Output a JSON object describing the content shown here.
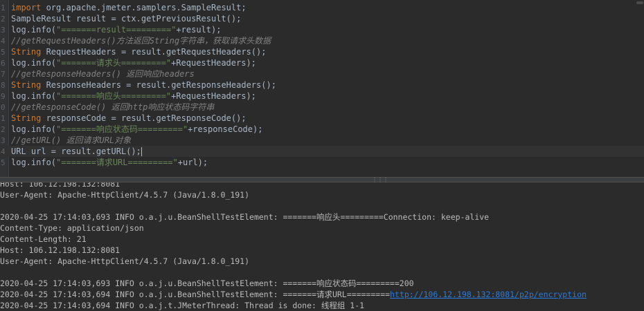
{
  "editor": {
    "lines": [
      {
        "n": "1",
        "parts": [
          {
            "t": "kw",
            "v": "import"
          },
          {
            "t": "plain",
            "v": " org.apache.jmeter.samplers.SampleResult;"
          }
        ]
      },
      {
        "n": "2",
        "parts": [
          {
            "t": "plain",
            "v": "SampleResult result = ctx.getPreviousResult();"
          }
        ]
      },
      {
        "n": "3",
        "parts": [
          {
            "t": "plain",
            "v": "log.info("
          },
          {
            "t": "str",
            "v": "\"=======result=========\""
          },
          {
            "t": "plain",
            "v": "+result);"
          }
        ]
      },
      {
        "n": "4",
        "parts": [
          {
            "t": "cmt",
            "v": "//getRequestHeaders()方法返回String字符串，获取请求头数据"
          }
        ]
      },
      {
        "n": "5",
        "parts": [
          {
            "t": "kw",
            "v": "String"
          },
          {
            "t": "plain",
            "v": " RequestHeaders = result.getRequestHeaders();"
          }
        ]
      },
      {
        "n": "6",
        "parts": [
          {
            "t": "plain",
            "v": "log.info("
          },
          {
            "t": "str",
            "v": "\"=======请求头=========\""
          },
          {
            "t": "plain",
            "v": "+RequestHeaders);"
          }
        ]
      },
      {
        "n": "7",
        "parts": [
          {
            "t": "cmt",
            "v": "//getResponseHeaders() 返回响应headers"
          }
        ]
      },
      {
        "n": "8",
        "parts": [
          {
            "t": "kw",
            "v": "String"
          },
          {
            "t": "plain",
            "v": " ResponseHeaders = result.getResponseHeaders();"
          }
        ]
      },
      {
        "n": "9",
        "parts": [
          {
            "t": "plain",
            "v": "log.info("
          },
          {
            "t": "str",
            "v": "\"=======响应头=========\""
          },
          {
            "t": "plain",
            "v": "+RequestHeaders);"
          }
        ]
      },
      {
        "n": "0",
        "parts": [
          {
            "t": "cmt",
            "v": "//getResponseCode() 返回http响应状态码字符串"
          }
        ]
      },
      {
        "n": "1",
        "parts": [
          {
            "t": "kw",
            "v": "String"
          },
          {
            "t": "plain",
            "v": " responseCode = result.getResponseCode();"
          }
        ]
      },
      {
        "n": "2",
        "parts": [
          {
            "t": "plain",
            "v": "log.info("
          },
          {
            "t": "str",
            "v": "\"=======响应状态码=========\""
          },
          {
            "t": "plain",
            "v": "+responseCode);"
          }
        ]
      },
      {
        "n": "3",
        "parts": [
          {
            "t": "cmt",
            "v": "//getURL() 返回请求URL对象"
          }
        ]
      },
      {
        "n": "4",
        "parts": [
          {
            "t": "plain",
            "v": "URL url = result.getURL();"
          }
        ],
        "active": true
      },
      {
        "n": "5",
        "parts": [
          {
            "t": "plain",
            "v": "log.info("
          },
          {
            "t": "str",
            "v": "\"=======请求URL=========\""
          },
          {
            "t": "plain",
            "v": "+url);"
          }
        ]
      }
    ]
  },
  "console": {
    "lines": [
      {
        "text": "Host: 106.12.198.132:8081"
      },
      {
        "text": "User-Agent: Apache-HttpClient/4.5.7 (Java/1.8.0_191)"
      },
      {
        "text": ""
      },
      {
        "text": "2020-04-25 17:14:03,693 INFO o.a.j.u.BeanShellTestElement: =======响应头=========Connection: keep-alive"
      },
      {
        "text": "Content-Type: application/json"
      },
      {
        "text": "Content-Length: 21"
      },
      {
        "text": "Host: 106.12.198.132:8081"
      },
      {
        "text": "User-Agent: Apache-HttpClient/4.5.7 (Java/1.8.0_191)"
      },
      {
        "text": ""
      },
      {
        "text": "2020-04-25 17:14:03,693 INFO o.a.j.u.BeanShellTestElement: =======响应状态码=========200"
      },
      {
        "text": "2020-04-25 17:14:03,694 INFO o.a.j.u.BeanShellTestElement: =======请求URL=========",
        "link": "http://106.12.198.132:8081/p2p/encryption"
      },
      {
        "text": "2020-04-25 17:14:03,694 INFO o.a.j.t.JMeterThread: Thread is done: 线程组 1-1"
      }
    ]
  },
  "colors": {
    "background": "#2b2b2b",
    "keyword": "#cc7832",
    "string": "#6a8759",
    "comment": "#808080",
    "plain": "#a9b7c6",
    "link": "#287bde"
  },
  "icons": {
    "splitter_grip": "grip-dots-icon"
  }
}
